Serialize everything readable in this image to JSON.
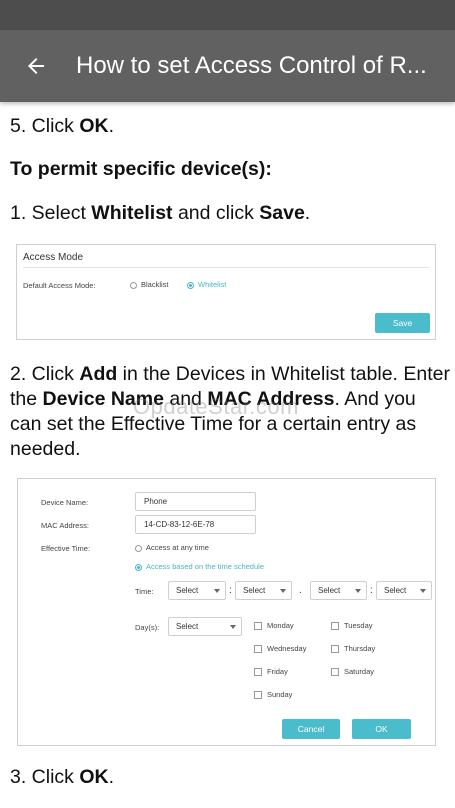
{
  "appbar": {
    "title": "How to set Access Control of R..."
  },
  "steps": {
    "step5": {
      "num": "5. Click ",
      "bold": "OK",
      "tail": "."
    },
    "heading": "To permit specific device(s):",
    "step1": {
      "num": "1. Select ",
      "bold1": "Whitelist",
      "mid": " and click ",
      "bold2": "Save",
      "tail": "."
    },
    "step2": {
      "a": "2. Click ",
      "b": "Add",
      "c": " in the Devices in Whitelist table. Enter the ",
      "d": "Device Name",
      "e": " and ",
      "f": "MAC Address",
      "g": ". And you can set the Effective Time for a certain entry as needed."
    },
    "step3": {
      "num": "3. Click ",
      "bold": "OK",
      "tail": "."
    }
  },
  "watermark": "OpdateStar.com",
  "shot1": {
    "title": "Access Mode",
    "label": "Default Access Mode:",
    "option1": "Blacklist",
    "option2": "Whitelist",
    "save": "Save"
  },
  "shot2": {
    "device_name_label": "Device Name:",
    "device_name_value": "Phone",
    "mac_label": "MAC Address:",
    "mac_value": "14-CD-83-12-6E-78",
    "effective_label": "Effective Time:",
    "radio1": "Access at any time",
    "radio2": "Access based on the time schedule",
    "time_label": "Time:",
    "select": "Select",
    "colon": ":",
    "dot": ".",
    "days_label": "Day(s):",
    "days": [
      "Monday",
      "Tuesday",
      "Wednesday",
      "Thursday",
      "Friday",
      "Saturday",
      "Sunday"
    ],
    "cancel": "Cancel",
    "ok": "OK"
  },
  "colors": {
    "accent": "#4bbccc",
    "appbar": "#616161",
    "statusbar": "#4d4d4d"
  },
  "icons": {
    "back": "arrow-left-icon"
  }
}
